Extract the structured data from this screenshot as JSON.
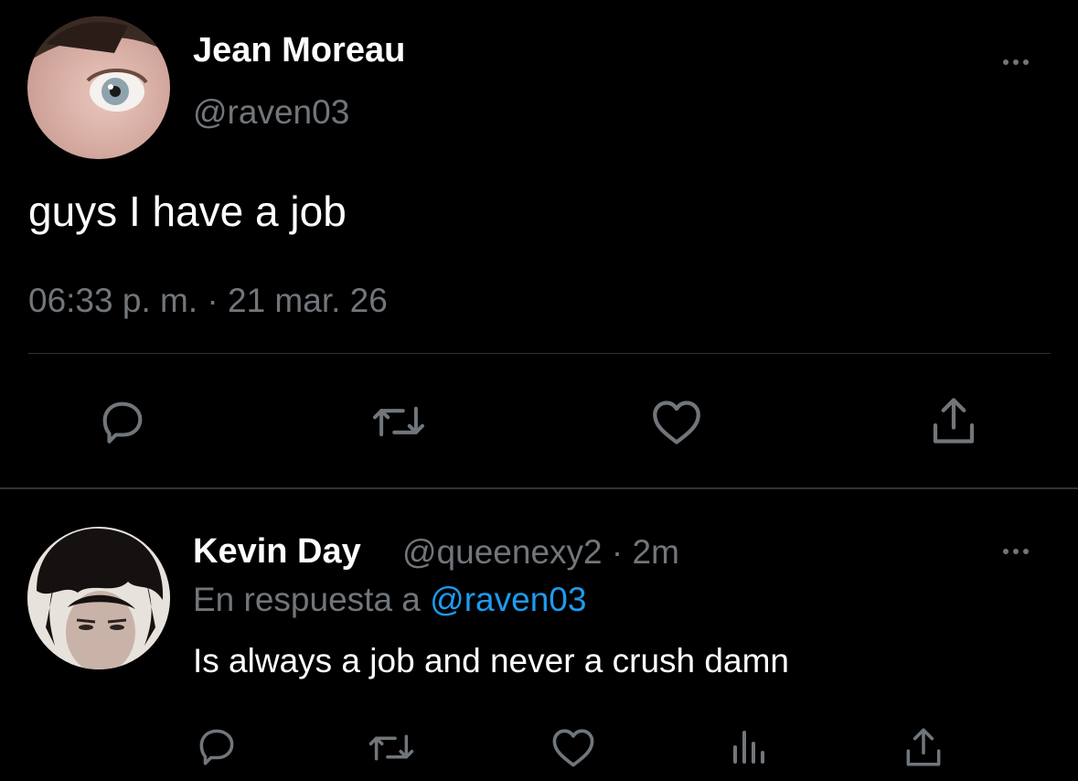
{
  "main_tweet": {
    "author_name": "Jean Moreau",
    "author_handle": "@raven03",
    "text": "guys I have a job",
    "timestamp": "06:33 p. m. · 21 mar. 26",
    "actions": [
      "reply-icon",
      "retweet-icon",
      "like-icon",
      "share-icon"
    ]
  },
  "reply": {
    "author_name": "Kevin Day",
    "author_handle": "@queenexy2",
    "separator": "·",
    "time_ago": "2m",
    "in_reply_to_label": "En respuesta a",
    "in_reply_to_handle": "@raven03",
    "text": "Is always a job and never a crush damn",
    "actions": [
      "reply-icon",
      "retweet-icon",
      "like-icon",
      "analytics-icon",
      "share-icon"
    ]
  },
  "colors": {
    "background": "#000000",
    "primary_text": "#ffffff",
    "secondary_text": "#71767b",
    "link": "#1d9bf0",
    "divider": "#2f3336"
  }
}
